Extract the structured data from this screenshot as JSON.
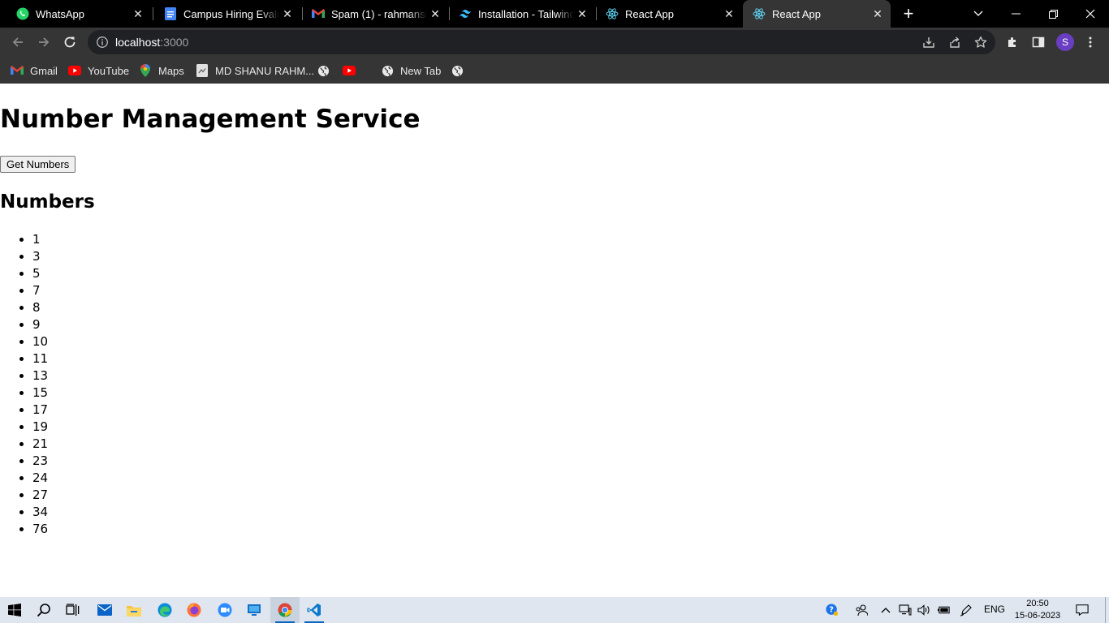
{
  "browser": {
    "tabs": [
      {
        "title": "WhatsApp",
        "icon": "whatsapp-icon",
        "active": false
      },
      {
        "title": "Campus Hiring Evaluation",
        "icon": "google-docs-icon",
        "active": false
      },
      {
        "title": "Spam (1) - rahmanshanu",
        "icon": "gmail-icon",
        "active": false
      },
      {
        "title": "Installation - Tailwind CSS",
        "icon": "tailwind-icon",
        "active": false
      },
      {
        "title": "React App",
        "icon": "react-icon",
        "active": false
      },
      {
        "title": "React App",
        "icon": "react-icon",
        "active": true
      }
    ],
    "url_host": "localhost",
    "url_rest": ":3000",
    "profile_initial": "S",
    "bookmarks": [
      {
        "label": "Gmail",
        "icon": "gmail-icon"
      },
      {
        "label": "YouTube",
        "icon": "youtube-icon"
      },
      {
        "label": "Maps",
        "icon": "maps-icon"
      },
      {
        "label": "MD SHANU RAHM...",
        "icon": "page-icon"
      },
      {
        "label": "",
        "icon": "globe-icon"
      },
      {
        "label": "",
        "icon": "youtube-icon"
      },
      {
        "label": "New Tab",
        "icon": "globe-icon"
      },
      {
        "label": "",
        "icon": "globe-icon"
      }
    ]
  },
  "page": {
    "title": "Number Management Service",
    "button_label": "Get Numbers",
    "numbers_heading": "Numbers",
    "numbers": [
      "1",
      "3",
      "5",
      "7",
      "8",
      "9",
      "10",
      "11",
      "13",
      "15",
      "17",
      "19",
      "21",
      "23",
      "24",
      "27",
      "34",
      "76"
    ]
  },
  "taskbar": {
    "language": "ENG",
    "time": "20:50",
    "date": "15-06-2023"
  },
  "colors": {
    "tabstrip_bg": "#000000",
    "toolbar_bg": "#353535",
    "omnibox_bg": "#202124",
    "avatar_bg": "#6a3ec2",
    "taskbar_bg": "#dfe6ef"
  }
}
